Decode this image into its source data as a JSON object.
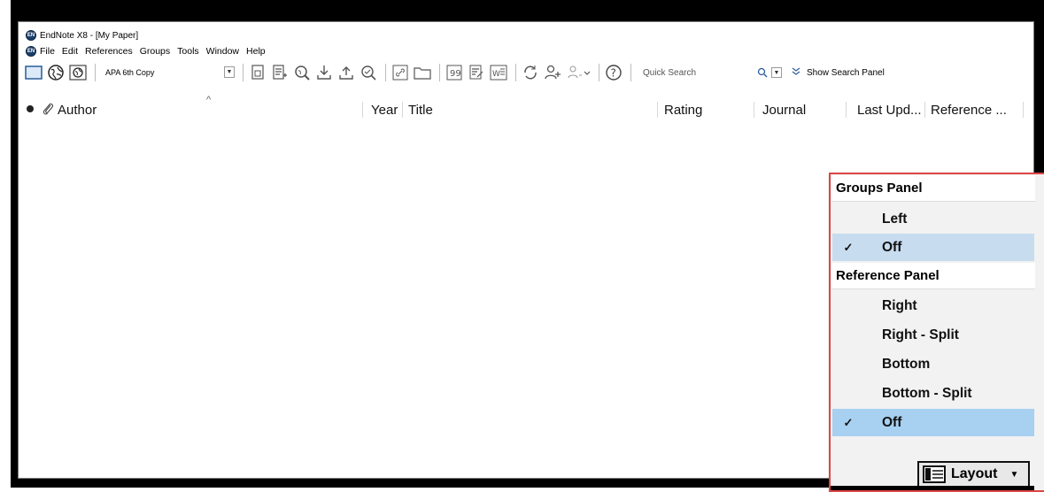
{
  "window": {
    "title": "EndNote X8 - [My Paper]"
  },
  "menubar": [
    "File",
    "Edit",
    "References",
    "Groups",
    "Tools",
    "Window",
    "Help"
  ],
  "toolbar": {
    "style_value": "APA 6th Copy",
    "quick_search_placeholder": "Quick Search",
    "show_search_panel": "Show Search Panel"
  },
  "columns": {
    "author": "Author",
    "year": "Year",
    "title": "Title",
    "rating": "Rating",
    "journal": "Journal",
    "last_updated": "Last Upd...",
    "reference_type": "Reference ..."
  },
  "layout_menu": {
    "groups_header": "Groups Panel",
    "groups_items": [
      {
        "label": "Left",
        "checked": false
      },
      {
        "label": "Off",
        "checked": true
      }
    ],
    "reference_header": "Reference Panel",
    "reference_items": [
      {
        "label": "Right",
        "checked": false
      },
      {
        "label": "Right - Split",
        "checked": false
      },
      {
        "label": "Bottom",
        "checked": false
      },
      {
        "label": "Bottom - Split",
        "checked": false
      },
      {
        "label": "Off",
        "checked": true
      }
    ],
    "check_glyph": "✓",
    "button_label": "Layout"
  }
}
